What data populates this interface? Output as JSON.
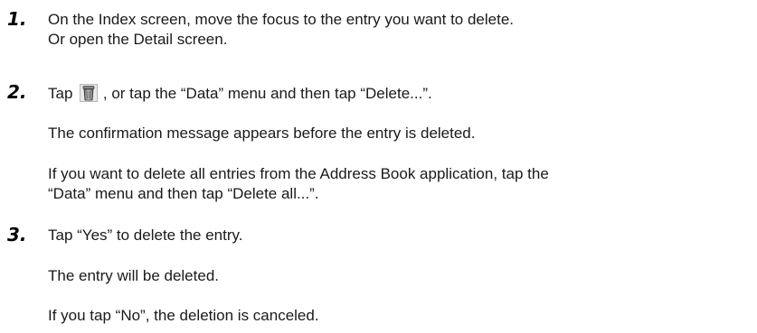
{
  "steps": [
    {
      "number": "1.",
      "lines": [
        "On the Index screen, move the focus to the entry you want to delete.",
        "Or open the Detail screen."
      ]
    },
    {
      "number": "2.",
      "line_before_icon": "Tap",
      "icon": "trash-can-icon",
      "line_after_icon": ", or tap the “Data” menu and then tap “Delete...”.",
      "paragraphs": [
        "The confirmation message appears before the entry is deleted.",
        "If you want to delete all entries from the Address Book application, tap the",
        "“Data” menu and then tap “Delete all...”."
      ]
    },
    {
      "number": "3.",
      "lines": [
        "Tap “Yes” to delete the entry."
      ],
      "paragraphs": [
        "The entry will be deleted.",
        "If you tap “No”, the deletion is canceled."
      ]
    }
  ]
}
